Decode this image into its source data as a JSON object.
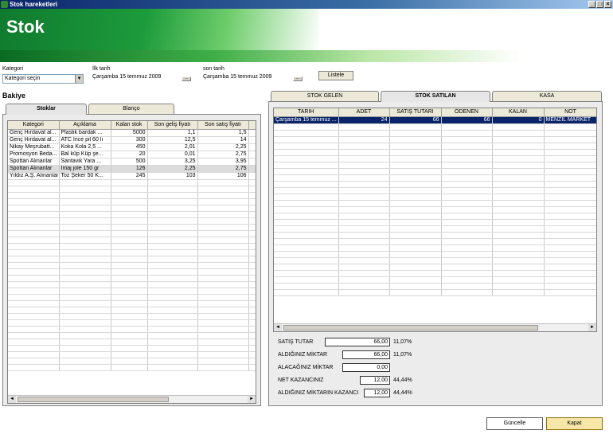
{
  "window": {
    "title": "Stok hareketleri"
  },
  "banner": {
    "title": "Stok"
  },
  "filters": {
    "kategori_label": "Kategori",
    "kategori_value": "Kategori seçin",
    "ilk_tarih_label": "İlk tarih",
    "ilk_tarih_value": "Çarşamba 15 temmuz 2009",
    "son_tarih_label": "son tarih",
    "son_tarih_value": "Çarşamba 15 temmuz 2009",
    "date_button": "...",
    "list_button": "Listele"
  },
  "left": {
    "section_title": "Bakiye",
    "tabs": [
      "Stoklar",
      "Blanço"
    ],
    "columns": [
      "Kategori",
      "Açıklama",
      "Kalan stok",
      "Son geliş fiyatı",
      "Son satış fiyatı"
    ],
    "rows": [
      [
        "Genç Hırdavat al...",
        "Plastik bardak ...",
        "5000",
        "1,1",
        "1,5"
      ],
      [
        "Genç Hırdavat al...",
        "ATC İnce pil 60 lı",
        "300",
        "12,5",
        "14"
      ],
      [
        "Nikay Meşrubatt...",
        "Koka Kola 2,5 ...",
        "450",
        "2,01",
        "2,25"
      ],
      [
        "Promosyon Beda...",
        "Bal küp Küp şe...",
        "20",
        "0,01",
        "2,75"
      ],
      [
        "Spottan Alınanlar",
        "Santavik Yara ...",
        "500",
        "3,25",
        "3,95"
      ],
      [
        "Spottan Alınanlar",
        "İmaj jole 150 gr",
        "126",
        "2,25",
        "2,75"
      ],
      [
        "Yıldız A.Ş. Alınanlar",
        "Toz Şeker 50 K...",
        "245",
        "103",
        "106"
      ]
    ]
  },
  "right": {
    "tabs": [
      "STOK GELEN",
      "STOK SATILAN",
      "KASA"
    ],
    "columns": [
      "TARİH",
      "ADET",
      "SATIŞ TUTARI",
      "ÖDENEN",
      "KALAN",
      "NOT"
    ],
    "rows": [
      [
        "Çarşamba 15 temmuz ...",
        "24",
        "66",
        "66",
        "0",
        "MENZİL MARKET"
      ]
    ],
    "summary": [
      {
        "label": "SATIŞ TUTAR",
        "value": "66,00",
        "pct": "11,07%"
      },
      {
        "label": "ALDIĞINIZ MİKTAR",
        "value": "66,00",
        "pct": "11,07%"
      },
      {
        "label": "ALACAĞINIZ MİKTAR",
        "value": "0,00",
        "pct": ""
      },
      {
        "label": "NET KAZANCINIZ",
        "value": "12,00",
        "pct": "44,44%"
      },
      {
        "label": "ALDIĞINIZ MİKTARIN KAZANCI",
        "value": "12,00",
        "pct": "44,44%"
      }
    ]
  },
  "footer": {
    "refresh_button": "Güncelle",
    "close_button": "Kapat"
  }
}
